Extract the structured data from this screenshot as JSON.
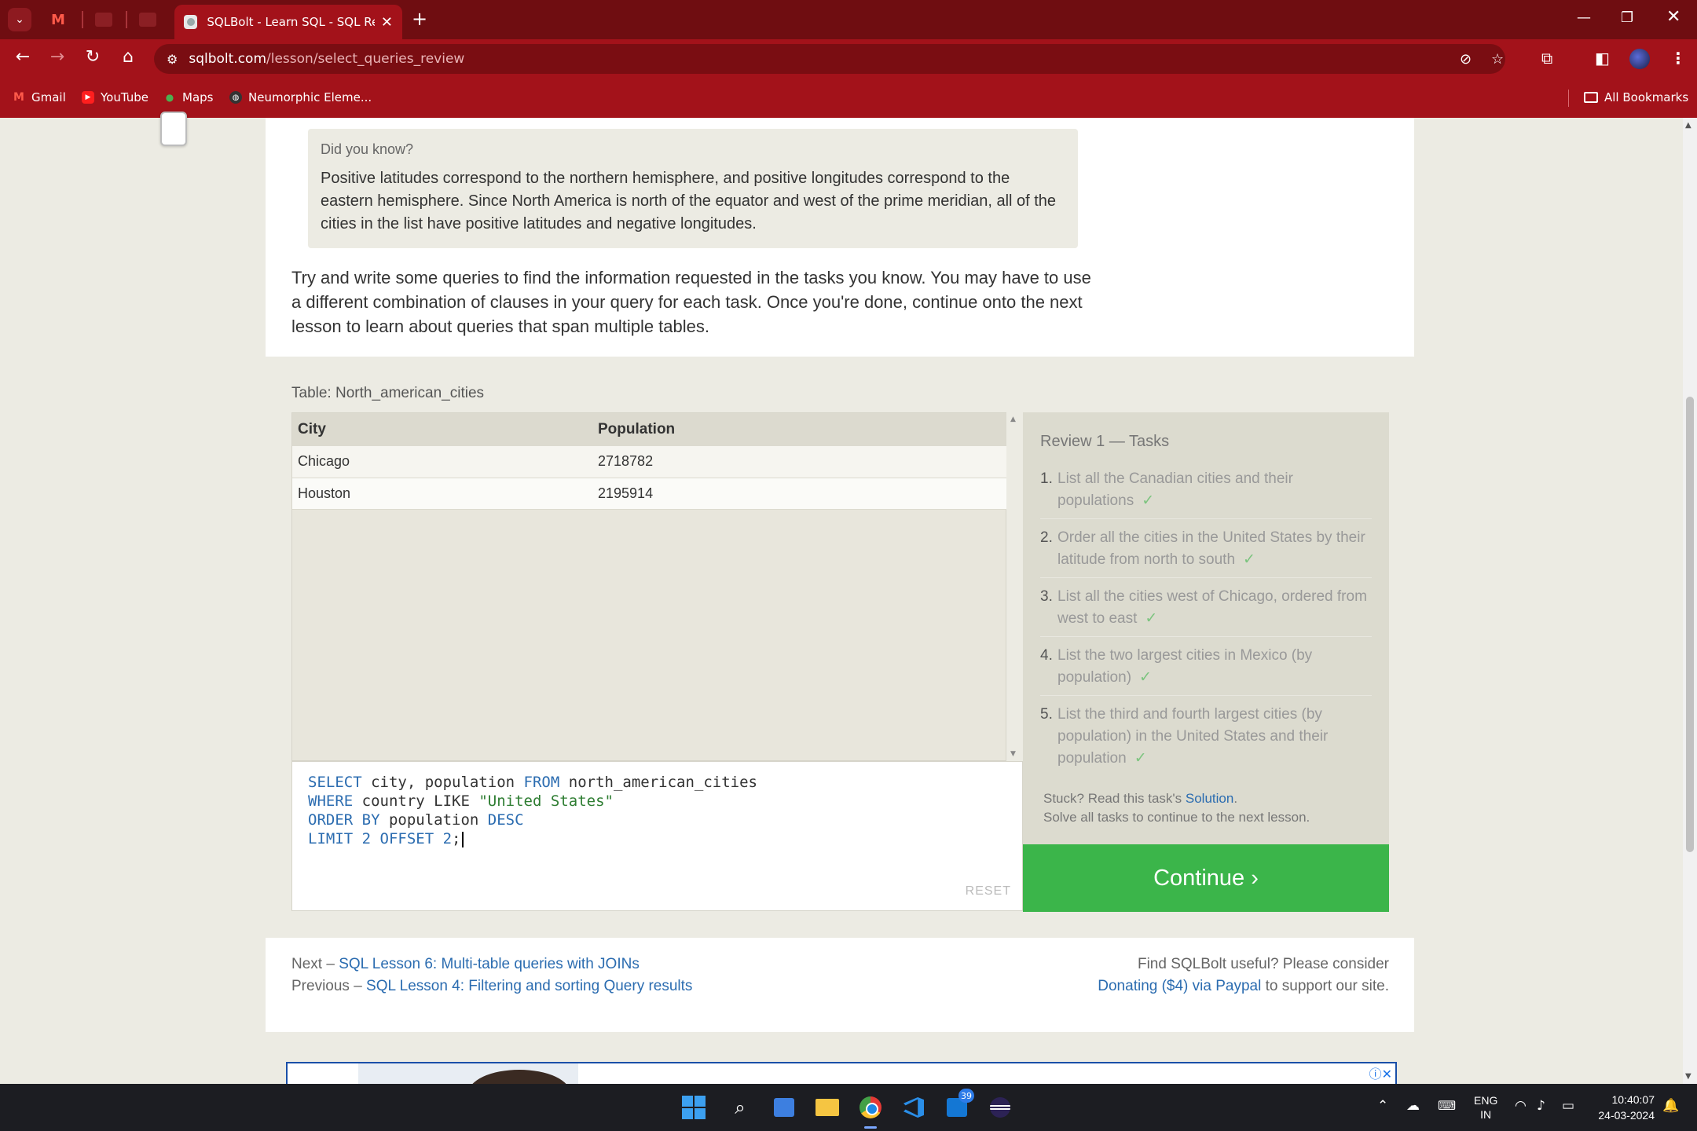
{
  "browser": {
    "active_tab_title": "SQLBolt - Learn SQL - SQL Review",
    "tab_close": "✕",
    "new_tab": "+",
    "url_host": "sqlbolt.com",
    "url_path": "/lesson/select_queries_review",
    "bookmarks": [
      "Gmail",
      "YouTube",
      "Maps",
      "Neumorphic Eleme..."
    ],
    "all_bookmarks": "All Bookmarks"
  },
  "callout": {
    "title": "Did you know?",
    "body": "Positive latitudes correspond to the northern hemisphere, and positive longitudes correspond to the eastern hemisphere. Since North America is north of the equator and west of the prime meridian, all of the cities in the list have positive latitudes and negative longitudes."
  },
  "intro": "Try and write some queries to find the information requested in the tasks you know. You may have to use a different combination of clauses in your query for each task. Once you're done, continue onto the next lesson to learn about queries that span multiple tables.",
  "results": {
    "label": "Table: North_american_cities",
    "headers": [
      "City",
      "Population"
    ],
    "rows": [
      [
        "Chicago",
        "2718782"
      ],
      [
        "Houston",
        "2195914"
      ]
    ]
  },
  "editor": {
    "line1": {
      "kw1": "SELECT",
      "t1": " city, population ",
      "kw2": "FROM",
      "t2": " north_american_cities"
    },
    "line2": {
      "kw1": "WHERE",
      "t1": " country LIKE ",
      "str": "\"United States\""
    },
    "line3": {
      "kw1": "ORDER BY",
      "t1": " population ",
      "kw2": "DESC"
    },
    "line4": {
      "kw1": "LIMIT 2 OFFSET 2",
      "t1": ";"
    },
    "reset": "RESET"
  },
  "tasks": {
    "title": "Review 1 — Tasks",
    "items": [
      {
        "num": "1.",
        "text": "List all the Canadian cities and their populations",
        "done": "✓"
      },
      {
        "num": "2.",
        "text": "Order all the cities in the United States by their latitude from north to south",
        "done": "✓"
      },
      {
        "num": "3.",
        "text": "List all the cities west of Chicago, ordered from west to east",
        "done": "✓"
      },
      {
        "num": "4.",
        "text": "List the two largest cities in Mexico (by population)",
        "done": "✓"
      },
      {
        "num": "5.",
        "text": "List the third and fourth largest cities (by population) in the United States and their population",
        "done": "✓"
      }
    ],
    "stuck_prefix": "Stuck? Read this task's ",
    "solution_link": "Solution",
    "stuck_suffix": ".",
    "solve_note": "Solve all tasks to continue to the next lesson.",
    "continue_label": "Continue ›"
  },
  "footer": {
    "next_prefix": "Next – ",
    "next_link": "SQL Lesson 6: Multi-table queries with JOINs",
    "prev_prefix": "Previous – ",
    "prev_link": "SQL Lesson 4: Filtering and sorting Query results",
    "donate_line1": "Find SQLBolt useful? Please consider",
    "donate_link": "Donating ($4) via Paypal",
    "donate_suffix": " to support our site."
  },
  "taskbar": {
    "outlook_badge": "39",
    "lang_line1": "ENG",
    "lang_line2": "IN",
    "time": "10:40:07",
    "date": "24-03-2024"
  },
  "colors": {
    "chrome_dark": "#6f0d11",
    "chrome_red": "#a3121a",
    "continue_green": "#3bb54a",
    "link_blue": "#2b6cb0"
  }
}
